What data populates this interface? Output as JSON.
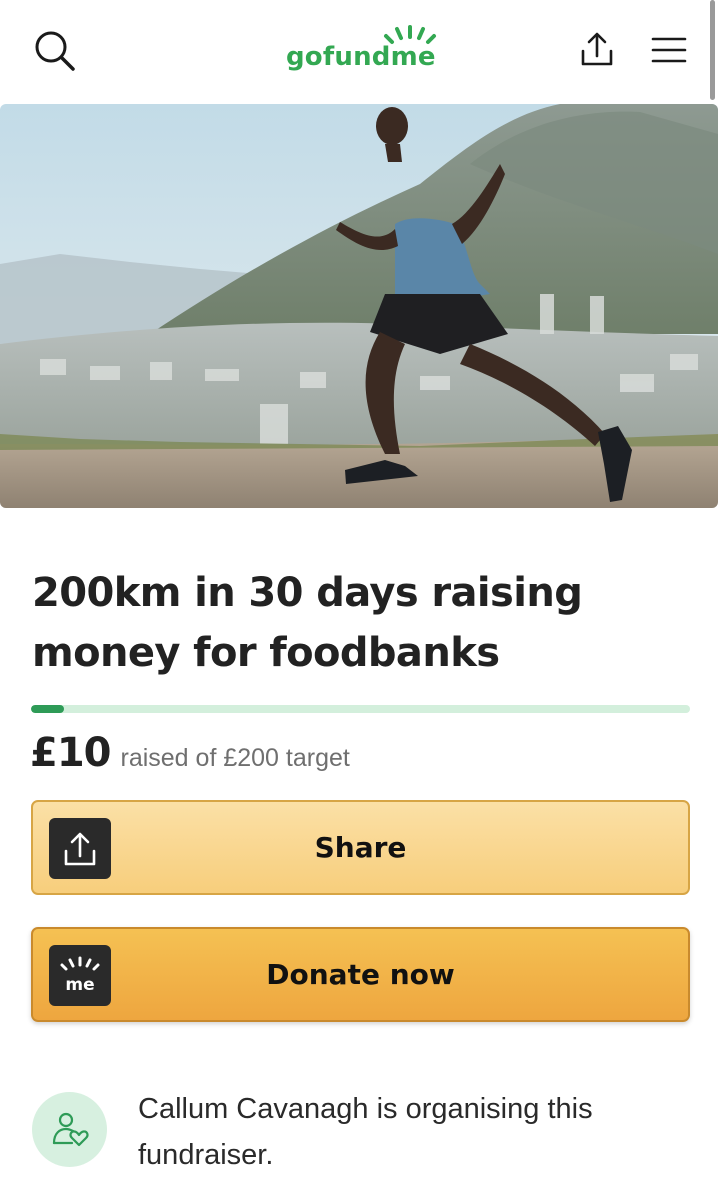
{
  "header": {
    "logo_text": "gofundme",
    "icons": [
      "search-icon",
      "share-icon",
      "menu-icon"
    ]
  },
  "hero": {
    "image_description": "runner on a mountain road above a coastal city"
  },
  "campaign": {
    "title": "200km in 30 days raising money for foodbanks",
    "raised_amount": "£10",
    "raised_text": "raised of £200 target",
    "progress_fraction": 0.05
  },
  "actions": {
    "share_label": "Share",
    "donate_label": "Donate now",
    "donate_icon_text": "me"
  },
  "organiser": {
    "text": "Callum Cavanagh is organising this fundraiser."
  },
  "colors": {
    "brand_green": "#33a852",
    "progress_track": "#d3efdc",
    "progress_fill": "#2e9b57",
    "share_button": "#f7ce7c",
    "donate_button": "#eea63f"
  }
}
